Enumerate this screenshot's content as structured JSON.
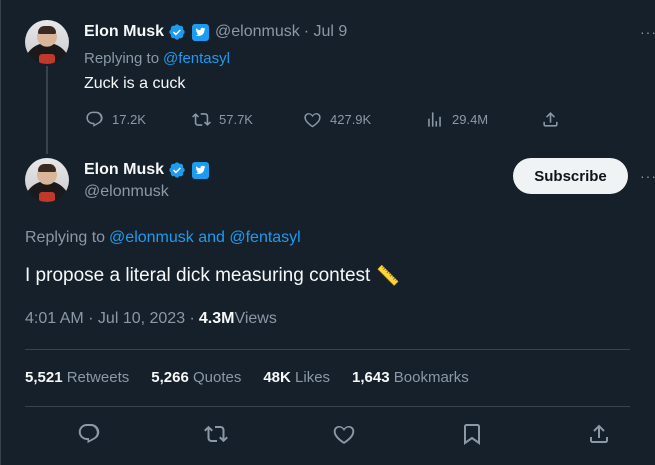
{
  "reply_tweet": {
    "author_name": "Elon Musk",
    "handle": "@elonmusk",
    "date": "· Jul 9",
    "replying_prefix": "Replying to ",
    "replying_to": "@fentasyl",
    "text": "Zuck is a cuck",
    "stats": {
      "replies": "17.2K",
      "retweets": "57.7K",
      "likes": "427.9K",
      "views": "29.4M"
    }
  },
  "main_tweet": {
    "author_name": "Elon Musk",
    "handle": "@elonmusk",
    "subscribe_label": "Subscribe",
    "replying_prefix": "Replying to ",
    "replying_to": "@elonmusk and @fentasyl",
    "text": "I propose a literal dick measuring contest",
    "emoji": "📏",
    "timestamp": "4:01 AM · Jul 10, 2023 · ",
    "views_count": "4.3M",
    "views_label": " Views",
    "engagement": [
      {
        "count": "5,521",
        "label": " Retweets"
      },
      {
        "count": "5,266",
        "label": " Quotes"
      },
      {
        "count": "48K",
        "label": " Likes"
      },
      {
        "count": "1,643",
        "label": " Bookmarks"
      }
    ]
  },
  "colors": {
    "background": "#15202b",
    "accent": "#1d9bf0",
    "muted": "#8b98a5",
    "border": "#38444d"
  },
  "icons": [
    "reply-icon",
    "retweet-icon",
    "like-icon",
    "views-icon",
    "share-icon",
    "bookmark-icon",
    "verified-icon",
    "government-badge-icon",
    "more-icon"
  ]
}
